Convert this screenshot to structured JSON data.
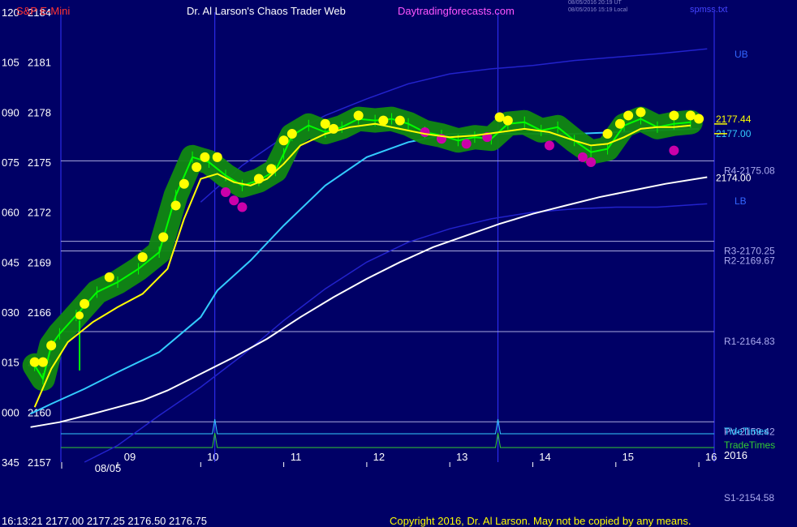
{
  "header": {
    "symbol": "S&P E-Mini",
    "title": "Dr. Al Larson's Chaos Trader Web",
    "site": "Daytradingforecasts.com",
    "stamp_utc": "08/05/2016 20:19 UT",
    "stamp_local": "08/05/2016 15:19 Local",
    "file": "spmss.txt"
  },
  "footer": {
    "status": "16:13:21  2177.00  2177.25  2176.50  2176.75",
    "copyright": "Copyright 2016, Dr. Al Larson. May not be copied by any means."
  },
  "colors": {
    "background": "#000066",
    "price": "#00ff00",
    "fast_ma": "#ffff00",
    "mid_ma": "#ff55ff",
    "cyan_ma": "#33ccff",
    "slow_ma": "#ffffff",
    "band": "#2222cc",
    "vertical_marker": "#3333ff",
    "band_glow": "#118811",
    "high_dot": "#ffff00",
    "low_dot": "#cc00aa"
  },
  "chart_data": {
    "type": "line",
    "title": "S&P E-Mini",
    "x_axis": {
      "labels": [
        "09",
        "10",
        "11",
        "12",
        "13",
        "14",
        "15",
        "16"
      ],
      "date": "08/05",
      "year": "2016"
    },
    "y_axis": {
      "degree_labels": [
        "120",
        "105",
        "090",
        "075",
        "060",
        "045",
        "030",
        "015",
        "000",
        "345"
      ],
      "price_labels": [
        "2184",
        "2181",
        "2178",
        "2175",
        "2172",
        "2169",
        "2166",
        "2163",
        "2160",
        "2157"
      ],
      "price_range": [
        2157,
        2184
      ]
    },
    "levels": [
      {
        "label": "R4-2175.08",
        "value": 2175.08
      },
      {
        "label": "R3-2170.25",
        "value": 2170.25
      },
      {
        "label": "R2-2169.67",
        "value": 2169.67
      },
      {
        "label": "R1-2164.83",
        "value": 2164.83
      },
      {
        "label": "PV-2159.42",
        "value": 2159.42
      },
      {
        "label": "S1-2154.58",
        "value": 2154.58
      }
    ],
    "timing_lines": [
      {
        "label": "TideTimes",
        "peaks": [
          10.17,
          13.58
        ]
      },
      {
        "label": "TradeTimes",
        "peaks": [
          10.17,
          13.58
        ]
      }
    ],
    "vertical_markers": [
      10.17,
      13.58
    ],
    "band_labels": {
      "upper": "UB",
      "lower": "LB"
    },
    "price_labels_right": [
      {
        "label": "2177.44",
        "value": 2177.44
      },
      {
        "label": "2177.00",
        "value": 2177.0
      },
      {
        "label": "2174.00",
        "value": 2174.0
      }
    ],
    "series": [
      {
        "key": "price",
        "x": [
          8.0,
          8.1,
          8.2,
          8.3,
          8.5,
          8.75,
          9.0,
          9.25,
          9.5,
          9.7,
          9.9,
          10.1,
          10.3,
          10.5,
          10.7,
          10.9,
          11.0,
          11.1,
          11.3,
          11.5,
          11.7,
          11.9,
          12.1,
          12.3,
          12.5,
          12.7,
          12.9,
          13.1,
          13.3,
          13.5,
          13.7,
          13.9,
          14.1,
          14.3,
          14.5,
          14.7,
          14.9,
          15.1,
          15.3,
          15.5,
          15.7,
          15.9
        ],
        "values": [
          2162.8,
          2162.0,
          2164.0,
          2164.7,
          2165.8,
          2167.2,
          2167.8,
          2168.6,
          2169.6,
          2173.0,
          2175.3,
          2175.0,
          2174.2,
          2173.6,
          2173.9,
          2174.5,
          2175.5,
          2176.6,
          2177.2,
          2176.8,
          2177.1,
          2177.6,
          2177.5,
          2177.6,
          2177.3,
          2176.8,
          2176.6,
          2176.3,
          2176.5,
          2176.4,
          2177.3,
          2177.4,
          2176.9,
          2177.1,
          2176.3,
          2175.6,
          2175.8,
          2177.2,
          2177.6,
          2177.1,
          2177.3,
          2177.4
        ]
      },
      {
        "key": "fast_ma",
        "x": [
          8.0,
          8.2,
          8.4,
          8.7,
          9.0,
          9.3,
          9.6,
          9.8,
          10.0,
          10.2,
          10.4,
          10.6,
          10.8,
          11.0,
          11.2,
          11.5,
          11.8,
          12.1,
          12.4,
          12.7,
          13.0,
          13.3,
          13.6,
          13.9,
          14.2,
          14.5,
          14.7,
          14.9,
          15.1,
          15.3,
          15.5,
          15.7,
          15.9
        ],
        "values": [
          2160.3,
          2162.6,
          2164.2,
          2165.4,
          2166.3,
          2167.1,
          2168.6,
          2171.6,
          2174.0,
          2174.3,
          2173.8,
          2173.6,
          2174.0,
          2174.9,
          2176.0,
          2176.7,
          2177.1,
          2177.3,
          2177.0,
          2176.7,
          2176.5,
          2176.6,
          2176.8,
          2177.0,
          2176.8,
          2176.3,
          2176.0,
          2176.1,
          2176.5,
          2177.0,
          2177.1,
          2177.1,
          2177.2
        ]
      },
      {
        "key": "cyan_ma",
        "x": [
          7.95,
          8.2,
          8.6,
          9.0,
          9.5,
          10.0,
          10.2,
          10.6,
          11.0,
          11.5,
          12.0,
          12.5,
          13.0,
          13.5,
          14.0,
          14.5,
          15.0,
          15.5,
          16.0
        ],
        "values": [
          2159.9,
          2160.5,
          2161.4,
          2162.4,
          2163.6,
          2165.7,
          2167.3,
          2169.1,
          2171.2,
          2173.6,
          2175.3,
          2176.2,
          2176.7,
          2176.7,
          2176.7,
          2176.7,
          2176.8,
          2176.9,
          2177.0
        ]
      },
      {
        "key": "slow_ma",
        "x": [
          7.95,
          8.3,
          8.7,
          9.0,
          9.3,
          9.6,
          10.0,
          10.4,
          10.8,
          11.2,
          11.6,
          12.0,
          12.4,
          12.8,
          13.2,
          13.6,
          14.0,
          14.4,
          14.8,
          15.2,
          15.6,
          16.1
        ],
        "values": [
          2159.1,
          2159.4,
          2159.9,
          2160.3,
          2160.7,
          2161.3,
          2162.3,
          2163.3,
          2164.4,
          2165.7,
          2166.9,
          2168.0,
          2169.0,
          2169.9,
          2170.6,
          2171.3,
          2171.9,
          2172.4,
          2172.9,
          2173.3,
          2173.7,
          2174.1
        ]
      },
      {
        "key": "upper_band",
        "x": [
          10.0,
          10.5,
          11.0,
          11.5,
          12.0,
          12.5,
          13.0,
          13.5,
          14.0,
          14.5,
          15.0,
          15.5,
          16.1
        ],
        "values": [
          2172.6,
          2174.8,
          2176.5,
          2177.8,
          2178.8,
          2179.7,
          2180.3,
          2180.6,
          2180.8,
          2181.1,
          2181.3,
          2181.5,
          2181.8
        ]
      },
      {
        "key": "lower_band",
        "x": [
          8.6,
          9.0,
          9.5,
          10.0,
          10.5,
          11.0,
          11.5,
          12.0,
          12.5,
          13.0,
          13.5,
          14.0,
          14.5,
          15.0,
          15.5,
          16.1
        ],
        "values": [
          2157.0,
          2158.0,
          2159.8,
          2161.5,
          2163.4,
          2165.5,
          2167.4,
          2169.0,
          2170.2,
          2171.0,
          2171.6,
          2172.0,
          2172.2,
          2172.3,
          2172.3,
          2172.5
        ]
      }
    ],
    "high_dots": {
      "x": [
        8.0,
        8.1,
        8.2,
        8.6,
        8.9,
        9.3,
        9.55,
        9.7,
        9.8,
        9.95,
        10.05,
        10.2,
        10.7,
        10.85,
        11.0,
        11.1,
        11.5,
        11.6,
        11.9,
        12.2,
        12.4,
        13.6,
        13.7,
        14.9,
        15.05,
        15.15,
        15.3,
        15.7,
        15.9,
        16.0
      ],
      "values": [
        2163.0,
        2163.0,
        2164.0,
        2166.5,
        2168.1,
        2169.3,
        2170.5,
        2172.4,
        2173.7,
        2174.7,
        2175.3,
        2175.3,
        2174.0,
        2174.6,
        2176.3,
        2176.7,
        2177.3,
        2177.0,
        2177.8,
        2177.5,
        2177.5,
        2177.7,
        2177.5,
        2176.7,
        2177.3,
        2177.8,
        2178.0,
        2177.8,
        2177.8,
        2177.6
      ]
    },
    "low_dots": {
      "x": [
        10.3,
        10.4,
        10.5,
        12.7,
        12.9,
        13.2,
        13.45,
        14.2,
        14.6,
        14.7,
        15.7
      ],
      "values": [
        2173.2,
        2172.7,
        2172.3,
        2176.8,
        2176.4,
        2176.1,
        2176.5,
        2176.0,
        2175.3,
        2175.0,
        2175.7
      ]
    }
  }
}
